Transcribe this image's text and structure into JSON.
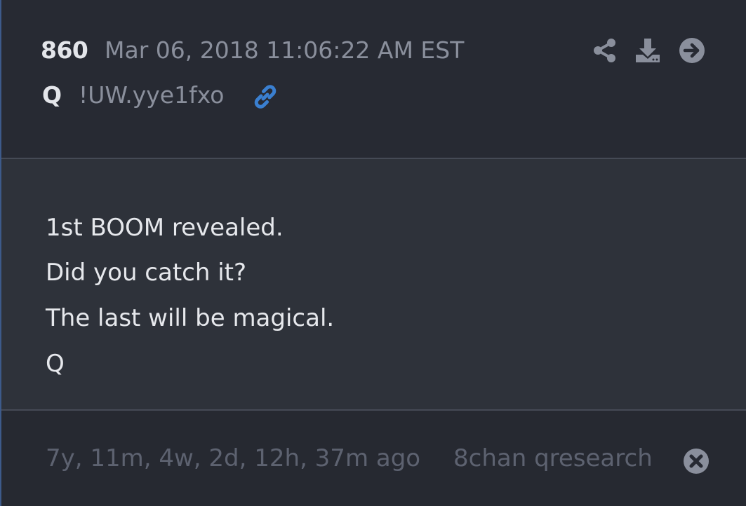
{
  "post": {
    "number": "860",
    "datetime": "Mar 06, 2018 11:06:22 AM EST",
    "author": "Q",
    "tripcode": "!UW.yye1fxo"
  },
  "header_actions": {
    "icons": [
      "share-icon",
      "download-icon",
      "arrow-right-circle-icon"
    ],
    "link_icon": "link-icon"
  },
  "message": {
    "lines": [
      "1st BOOM revealed.",
      "Did you catch it?",
      "The last will be magical.",
      "Q"
    ]
  },
  "footer": {
    "elapsed": "7y, 11m, 4w, 2d, 12h, 37m ago",
    "source": "8chan qresearch",
    "close_icon": "close-icon"
  },
  "colors": {
    "background": "#272a33",
    "body_background": "#2e323a",
    "text_primary": "#e6e8ec",
    "text_muted": "#8a8f9c",
    "text_faded": "#5d6270",
    "icon_gray": "#8a8f9c",
    "link_blue": "#3a7fd0",
    "accent_border": "#3d5a8a"
  }
}
